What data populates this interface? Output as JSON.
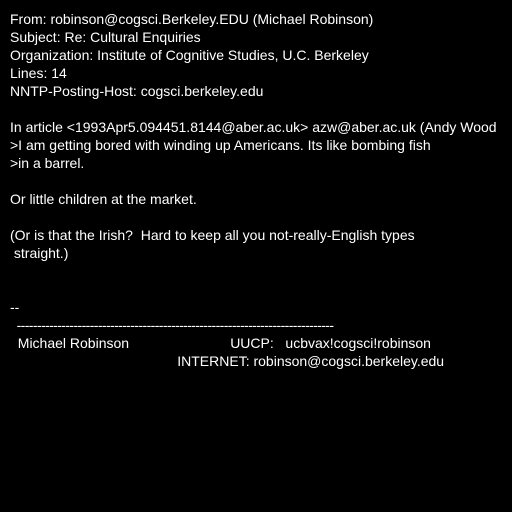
{
  "header": {
    "from": "From: robinson@cogsci.Berkeley.EDU (Michael Robinson)",
    "subject": "Subject: Re: Cultural Enquiries",
    "organization": "Organization: Institute of Cognitive Studies, U.C. Berkeley",
    "lines": "Lines: 14",
    "nntp_host": "NNTP-Posting-Host: cogsci.berkeley.edu"
  },
  "body": {
    "attribution": "In article <1993Apr5.094451.8144@aber.ac.uk> azw@aber.ac.uk (Andy Wood",
    "quote_1": ">I am getting bored with winding up Americans. Its like bombing fish",
    "quote_2": ">in a barrel.",
    "reply_1": "Or little children at the market.",
    "reply_2": "(Or is that the Irish?  Hard to keep all you not-really-English types",
    "reply_3": " straight.)"
  },
  "signature": {
    "separator": "--",
    "rule": "  ------------------------------------------------------------------------------",
    "name_line": "  Michael Robinson                          UUCP:   ucbvax!cogsci!robinson",
    "internet_line": "                                           INTERNET: robinson@cogsci.berkeley.edu"
  }
}
